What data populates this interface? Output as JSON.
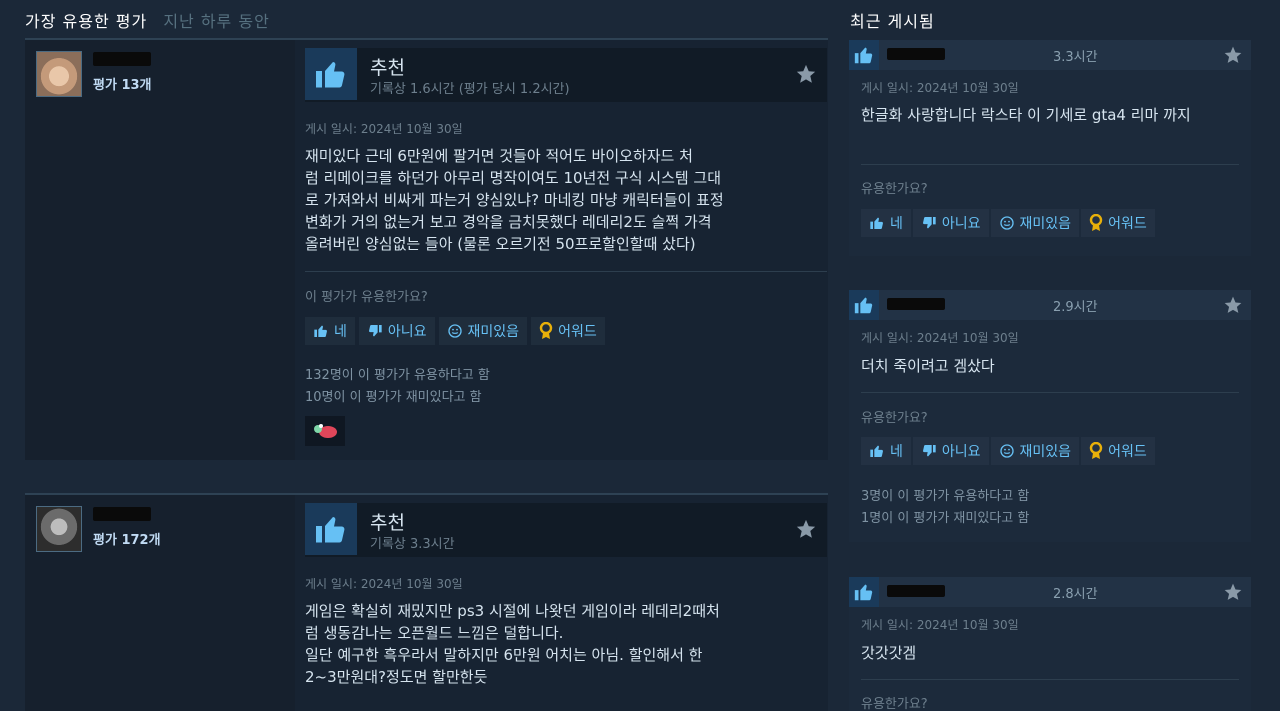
{
  "header": {
    "title": "가장 유용한 평가",
    "subtitle": "지난 하루 동안"
  },
  "side": {
    "title": "최근 게시됨"
  },
  "reviews": [
    {
      "review_count": "평가 13개",
      "recommendation": "추천",
      "playtime": "기록상 1.6시간 (평가 당시 1.2시간)",
      "posted": "게시 일시: 2024년 10월 30일",
      "body": "재미있다 근데 6만원에 팔거면 것들아 적어도 바이오하자드 처\n럼 리메이크를 하던가 아무리 명작이여도 10년전 구식 시스템 그대\n로 가져와서 비싸게 파는거 양심있냐? 마네킹 마냥 캐릭터들이 표정\n변화가 거의 없는거 보고 경악을 금치못했다 레데리2도 슬쩍 가격\n올려버린 양심없는  들아 (물론 오르기전 50프로할인할때 샀다)",
      "helpful_q": "이 평가가 유용한가요?",
      "yes": "네",
      "no": "아니요",
      "funny": "재미있음",
      "award": "어워드",
      "stat_helpful": "132명이 이 평가가 유용하다고 함",
      "stat_funny": "10명이 이 평가가 재미있다고 함"
    },
    {
      "review_count": "평가 172개",
      "recommendation": "추천",
      "playtime": "기록상 3.3시간",
      "posted": "게시 일시: 2024년 10월 30일",
      "body": "게임은 확실히 재밌지만 ps3 시절에 나왓던 게임이라 레데리2때처\n럼 생동감나는 오픈월드 느낌은 덜합니다.\n일단 예구한 흑우라서 말하지만 6만원 어치는 아님. 할인해서 한\n2~3만원대?정도면 할만한듯"
    }
  ],
  "recent": [
    {
      "hours": "3.3시간",
      "posted": "게시 일시: 2024년 10월 30일",
      "body": "한글화 사랑합니다 락스타 이 기세로 gta4 리마 까지",
      "helpful_q": "유용한가요?",
      "yes": "네",
      "no": "아니요",
      "funny": "재미있음",
      "award": "어워드"
    },
    {
      "hours": "2.9시간",
      "posted": "게시 일시: 2024년 10월 30일",
      "body": "더치 죽이려고 겜샀다",
      "helpful_q": "유용한가요?",
      "yes": "네",
      "no": "아니요",
      "funny": "재미있음",
      "award": "어워드",
      "stat_helpful": "3명이 이 평가가 유용하다고 함",
      "stat_funny": "1명이 이 평가가 재미있다고 함"
    },
    {
      "hours": "2.8시간",
      "posted": "게시 일시: 2024년 10월 30일",
      "body": "갓갓갓겜",
      "helpful_q": "유용한가요?"
    }
  ],
  "colors": {
    "background": "#1b2838",
    "accent": "#67c1f5",
    "award": "#e8b00a"
  }
}
